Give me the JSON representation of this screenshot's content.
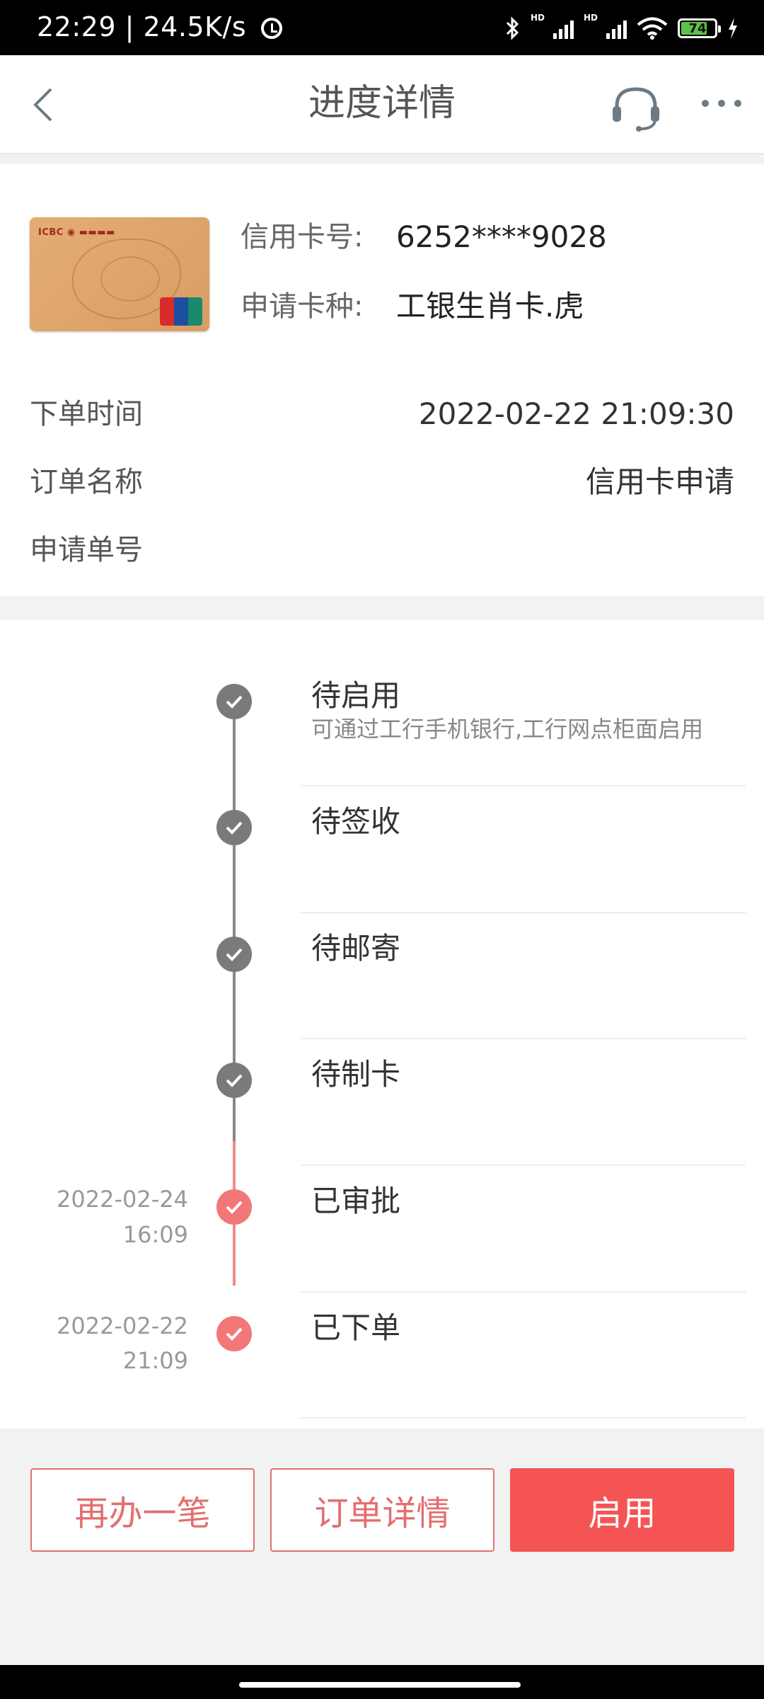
{
  "status_bar": {
    "time": "22:29",
    "speed": "24.5K/s",
    "battery": "74"
  },
  "header": {
    "title": "进度详情"
  },
  "card": {
    "card_no_label": "信用卡号:",
    "card_no": "6252****9028",
    "card_type_label": "申请卡种:",
    "card_type": "工银生肖卡.虎"
  },
  "order": {
    "time_label": "下单时间",
    "time_value": "2022-02-22 21:09:30",
    "name_label": "订单名称",
    "name_value": "信用卡申请",
    "number_label": "申请单号",
    "number_value": ""
  },
  "timeline": [
    {
      "title": "待启用",
      "subtitle": "可通过工行手机银行,工行网点柜面启用",
      "date": "",
      "time": "",
      "status": "done"
    },
    {
      "title": "待签收",
      "subtitle": "",
      "date": "",
      "time": "",
      "status": "done"
    },
    {
      "title": "待邮寄",
      "subtitle": "",
      "date": "",
      "time": "",
      "status": "done"
    },
    {
      "title": "待制卡",
      "subtitle": "",
      "date": "",
      "time": "",
      "status": "done"
    },
    {
      "title": "已审批",
      "subtitle": "",
      "date": "2022-02-24",
      "time": "16:09",
      "status": "completed"
    },
    {
      "title": "已下单",
      "subtitle": "",
      "date": "2022-02-22",
      "time": "21:09",
      "status": "completed"
    }
  ],
  "actions": {
    "again_label": "再办一笔",
    "detail_label": "订单详情",
    "activate_label": "启用"
  },
  "colors": {
    "accent": "#f45454",
    "done_gray": "#7a7a7a",
    "completed_red": "#f27878"
  },
  "icons": [
    "back-arrow-icon",
    "headset-icon",
    "more-icon",
    "check-icon",
    "bluetooth-icon",
    "wifi-icon",
    "alarm-icon",
    "battery-icon"
  ]
}
